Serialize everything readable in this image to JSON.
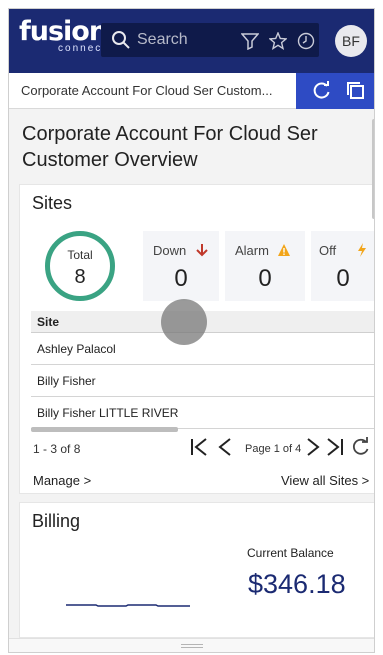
{
  "header": {
    "logo_text": "fusion",
    "logo_subtext": "connect",
    "search_placeholder": "Search",
    "avatar_initials": "BF"
  },
  "tabbar": {
    "label": "Corporate Account For Cloud Ser Custom..."
  },
  "page": {
    "title": "Corporate Account For Cloud Ser Customer Overview"
  },
  "sites": {
    "title": "Sites",
    "total_label": "Total",
    "total_value": "8",
    "stats": [
      {
        "label": "Down",
        "value": "0",
        "icon": "arrow-down-icon",
        "color": "#c0392b"
      },
      {
        "label": "Alarm",
        "value": "0",
        "icon": "warning-icon",
        "color": "#f2a51a"
      },
      {
        "label": "Off",
        "value": "0",
        "icon": "bolt-icon",
        "color": "#f2a51a"
      }
    ],
    "table": {
      "column": "Site",
      "rows": [
        "Ashley Palacol",
        "Billy Fisher",
        "Billy Fisher LITTLE RIVER"
      ]
    },
    "pager": {
      "count": "1 - 3 of 8",
      "page_text": "Page 1 of 4"
    },
    "manage_label": "Manage >",
    "view_all_label": "View all Sites >"
  },
  "billing": {
    "title": "Billing",
    "balance_label": "Current Balance",
    "balance_value": "$346.18"
  },
  "colors": {
    "header_bg": "#1b2a72",
    "accent": "#2e4bc4",
    "ring": "#3aa383"
  }
}
